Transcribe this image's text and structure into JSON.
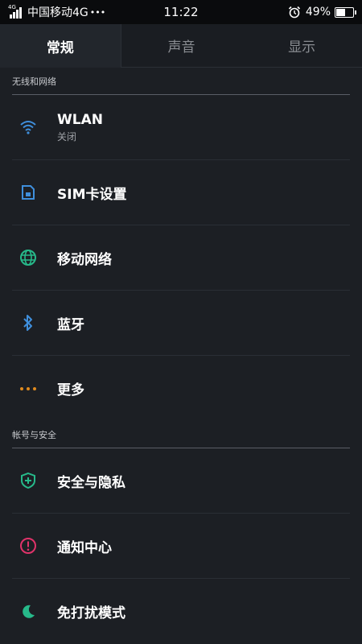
{
  "status_bar": {
    "network_tag": "4G",
    "carrier": "中国移动4G",
    "dots": "•••",
    "time": "11:22",
    "battery_percent": "49%",
    "battery_level": 0.49
  },
  "tabs": [
    {
      "label": "常规",
      "active": true
    },
    {
      "label": "声音",
      "active": false
    },
    {
      "label": "显示",
      "active": false
    }
  ],
  "sections": [
    {
      "header": "无线和网络",
      "items": [
        {
          "label": "WLAN",
          "sub": "关闭",
          "icon": "wifi-icon",
          "color": "#3f8fdc"
        },
        {
          "label": "SIM卡设置",
          "icon": "sim-card-icon",
          "color": "#3f8fdc"
        },
        {
          "label": "移动网络",
          "icon": "globe-icon",
          "color": "#27b98a"
        },
        {
          "label": "蓝牙",
          "icon": "bluetooth-icon",
          "color": "#3f8fdc"
        },
        {
          "label": "更多",
          "icon": "more-dots-icon",
          "color": "#e08a1e"
        }
      ]
    },
    {
      "header": "帐号与安全",
      "items": [
        {
          "label": "安全与隐私",
          "icon": "shield-icon",
          "color": "#27b98a"
        },
        {
          "label": "通知中心",
          "icon": "alert-circle-icon",
          "color": "#e0336a"
        },
        {
          "label": "免打扰模式",
          "icon": "moon-icon",
          "color": "#27b98a"
        }
      ]
    }
  ]
}
